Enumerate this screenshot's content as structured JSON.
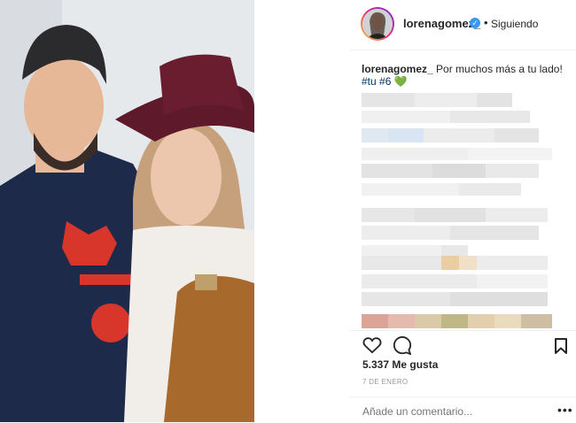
{
  "post": {
    "username": "lorenagomez_",
    "verified_icon": "verified-badge-icon",
    "separator": "•",
    "follow_status": "Siguiendo",
    "caption_user": "lorenagomez_",
    "caption_text": "Por muchos más a tu lado!",
    "hashtags": "#tu #6",
    "emoji": "💚",
    "likes": "5.337 Me gusta",
    "date": "7 DE ENERO",
    "comment_placeholder": "Añade un comentario...",
    "more_label": "•••"
  },
  "colors": {
    "link": "#003569",
    "verified": "#3897f0",
    "text": "#262626",
    "muted": "#999999"
  }
}
